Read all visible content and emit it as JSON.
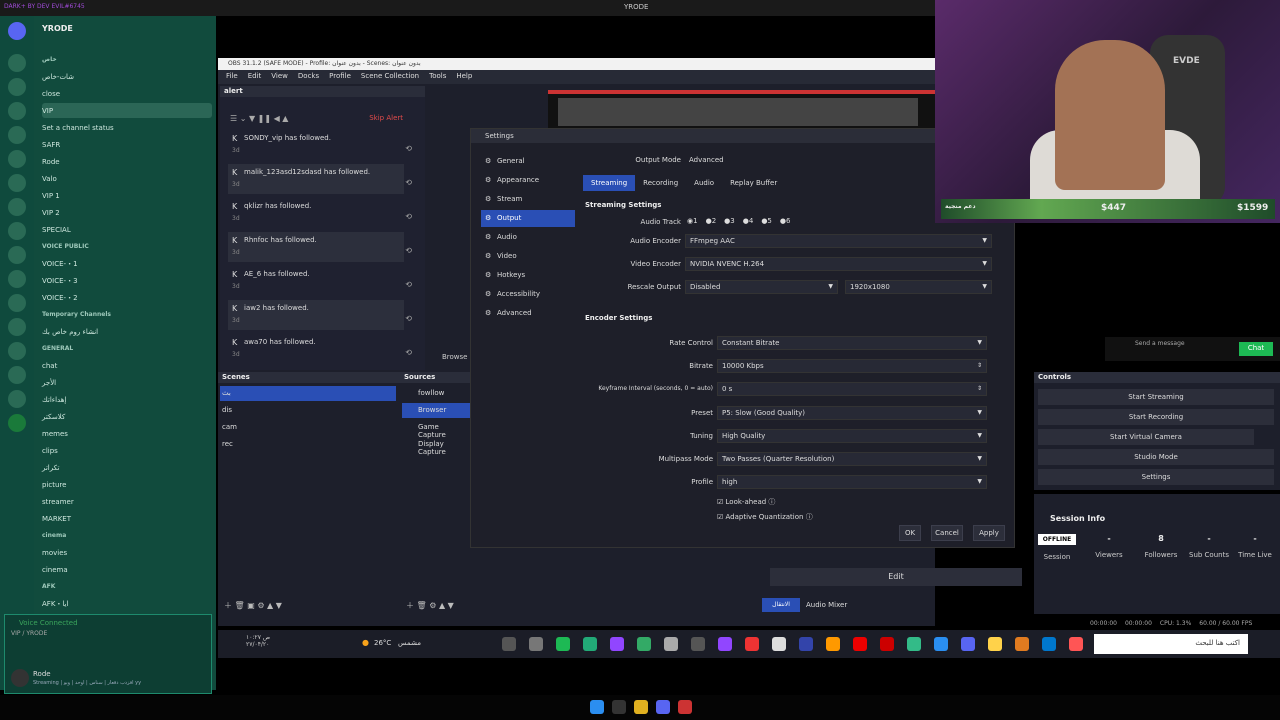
{
  "topbar": {
    "brand": "DARK+ BY DEV EVIL#6745",
    "title": "YRODE"
  },
  "discord": {
    "server_name": "YRODE",
    "channels": [
      {
        "label": "خاص",
        "cat": true
      },
      {
        "label": "شات-خاص"
      },
      {
        "label": "close"
      },
      {
        "label": "VIP",
        "sel": true
      },
      {
        "label": "Set a channel status"
      },
      {
        "label": "SAFR"
      },
      {
        "label": "Rode"
      },
      {
        "label": "Valo"
      },
      {
        "label": "VIP 1"
      },
      {
        "label": "VIP 2"
      },
      {
        "label": "SPECIAL"
      },
      {
        "label": "VOICE PUBLIC",
        "cat": true
      },
      {
        "label": "VOICE-・1"
      },
      {
        "label": "VOICE-・3"
      },
      {
        "label": "VOICE-・2"
      },
      {
        "label": "Temporary Channels",
        "cat": true
      },
      {
        "label": "انشاء روم خاص بك"
      },
      {
        "label": "GENERAL",
        "cat": true
      },
      {
        "label": "chat"
      },
      {
        "label": "الأجر"
      },
      {
        "label": "إهداءاتك"
      },
      {
        "label": "كلاسكتر"
      },
      {
        "label": "memes"
      },
      {
        "label": "clips"
      },
      {
        "label": "تكراتر"
      },
      {
        "label": "picture"
      },
      {
        "label": "streamer"
      },
      {
        "label": "MARKET"
      },
      {
        "label": "cinema",
        "cat": true
      },
      {
        "label": "movies"
      },
      {
        "label": "cinema"
      },
      {
        "label": "AFK",
        "cat": true
      },
      {
        "label": "AFK・ايا"
      }
    ],
    "voice_connected": "Voice Connected",
    "voice_channel": "VIP / YRODE",
    "user": "Rode",
    "user_status": "Streaming | افزدب دقعار | سناس | اوحد | ويو yy"
  },
  "obs": {
    "title": "OBS 31.1.2 (SAFE MODE) - Profile: بدون عنوان - Scenes: بدون عنوان",
    "menu": [
      "File",
      "Edit",
      "View",
      "Docks",
      "Profile",
      "Scene Collection",
      "Tools",
      "Help"
    ],
    "alert_title": "alert",
    "skip_alert": "Skip Alert",
    "followers": [
      {
        "name": "SONDY_vip has followed.",
        "d": "3d"
      },
      {
        "name": "malik_123asd12sdasd has followed.",
        "d": "3d"
      },
      {
        "name": "qklizr has followed.",
        "d": "3d"
      },
      {
        "name": "Rhnfoc has followed.",
        "d": "3d"
      },
      {
        "name": "AE_6 has followed.",
        "d": "3d"
      },
      {
        "name": "iaw2 has followed.",
        "d": "3d"
      },
      {
        "name": "awa70 has followed.",
        "d": "3d"
      }
    ],
    "scenes_title": "Scenes",
    "scenes": [
      "بث",
      "dis",
      "cam",
      "rec"
    ],
    "sources_title": "Sources",
    "sources": [
      "fowllow",
      "Browser",
      "Game Capture",
      "Display Capture"
    ],
    "preview_label": "Browse",
    "controls_title": "Controls",
    "controls": [
      "Start Streaming",
      "Start Recording",
      "Start Virtual Camera",
      "Studio Mode",
      "Settings"
    ],
    "session_title": "Session Info",
    "session": {
      "offline": "OFFLINE",
      "session_label": "Session",
      "viewers": "-",
      "viewers_label": "Viewers",
      "followers": "8",
      "followers_label": "Followers",
      "subs": "-",
      "subs_label": "Sub Counts",
      "time": "-",
      "time_label": "Time Live"
    },
    "edit": "Edit",
    "audio_mixer": "Audio Mixer",
    "transitions": "الانتقال",
    "status": {
      "rec": "00:00:00",
      "live": "00:00:00",
      "cpu": "CPU: 1.3%",
      "fps": "60.00 / 60.00 FPS"
    }
  },
  "settings": {
    "title": "Settings",
    "nav": [
      "General",
      "Appearance",
      "Stream",
      "Output",
      "Audio",
      "Video",
      "Hotkeys",
      "Accessibility",
      "Advanced"
    ],
    "output_mode_label": "Output Mode",
    "output_mode": "Advanced",
    "tabs": [
      "Streaming",
      "Recording",
      "Audio",
      "Replay Buffer"
    ],
    "streaming_settings": "Streaming Settings",
    "audio_track_label": "Audio Track",
    "tracks": [
      "1",
      "2",
      "3",
      "4",
      "5",
      "6"
    ],
    "audio_encoder_label": "Audio Encoder",
    "audio_encoder": "FFmpeg AAC",
    "video_encoder_label": "Video Encoder",
    "video_encoder": "NVIDIA NVENC H.264",
    "rescale_label": "Rescale Output",
    "rescale": "Disabled",
    "rescale_res": "1920x1080",
    "encoder_settings": "Encoder Settings",
    "rate_control_label": "Rate Control",
    "rate_control": "Constant Bitrate",
    "bitrate_label": "Bitrate",
    "bitrate": "10000 Kbps",
    "keyframe_label": "Keyframe Interval (seconds, 0 = auto)",
    "keyframe": "0 s",
    "preset_label": "Preset",
    "preset": "P5: Slow (Good Quality)",
    "tuning_label": "Tuning",
    "tuning": "High Quality",
    "multipass_label": "Multipass Mode",
    "multipass": "Two Passes (Quarter Resolution)",
    "profile_label": "Profile",
    "profile": "high",
    "lookahead": "Look-ahead",
    "adaptive": "Adaptive Quantization",
    "ok": "OK",
    "cancel": "Cancel",
    "apply": "Apply"
  },
  "webcam": {
    "goal_label": "دعم منجية",
    "amount1": "$447",
    "amount2": "$1599",
    "logo": "EVDE"
  },
  "chat": {
    "placeholder": "Send a message",
    "button": "Chat"
  },
  "taskbar": {
    "date": "ص ۱۰:۲۷\n۲۷/۰۴/۲۰",
    "weather": "26°C",
    "weather_desc": "مشمس",
    "search": "اكتب هنا للبحث"
  },
  "colors": {
    "discord_bg": "#114b3d",
    "obs_bg": "#1d1f2b",
    "accent": "#2a4fb5",
    "live": "#e02b2b"
  }
}
